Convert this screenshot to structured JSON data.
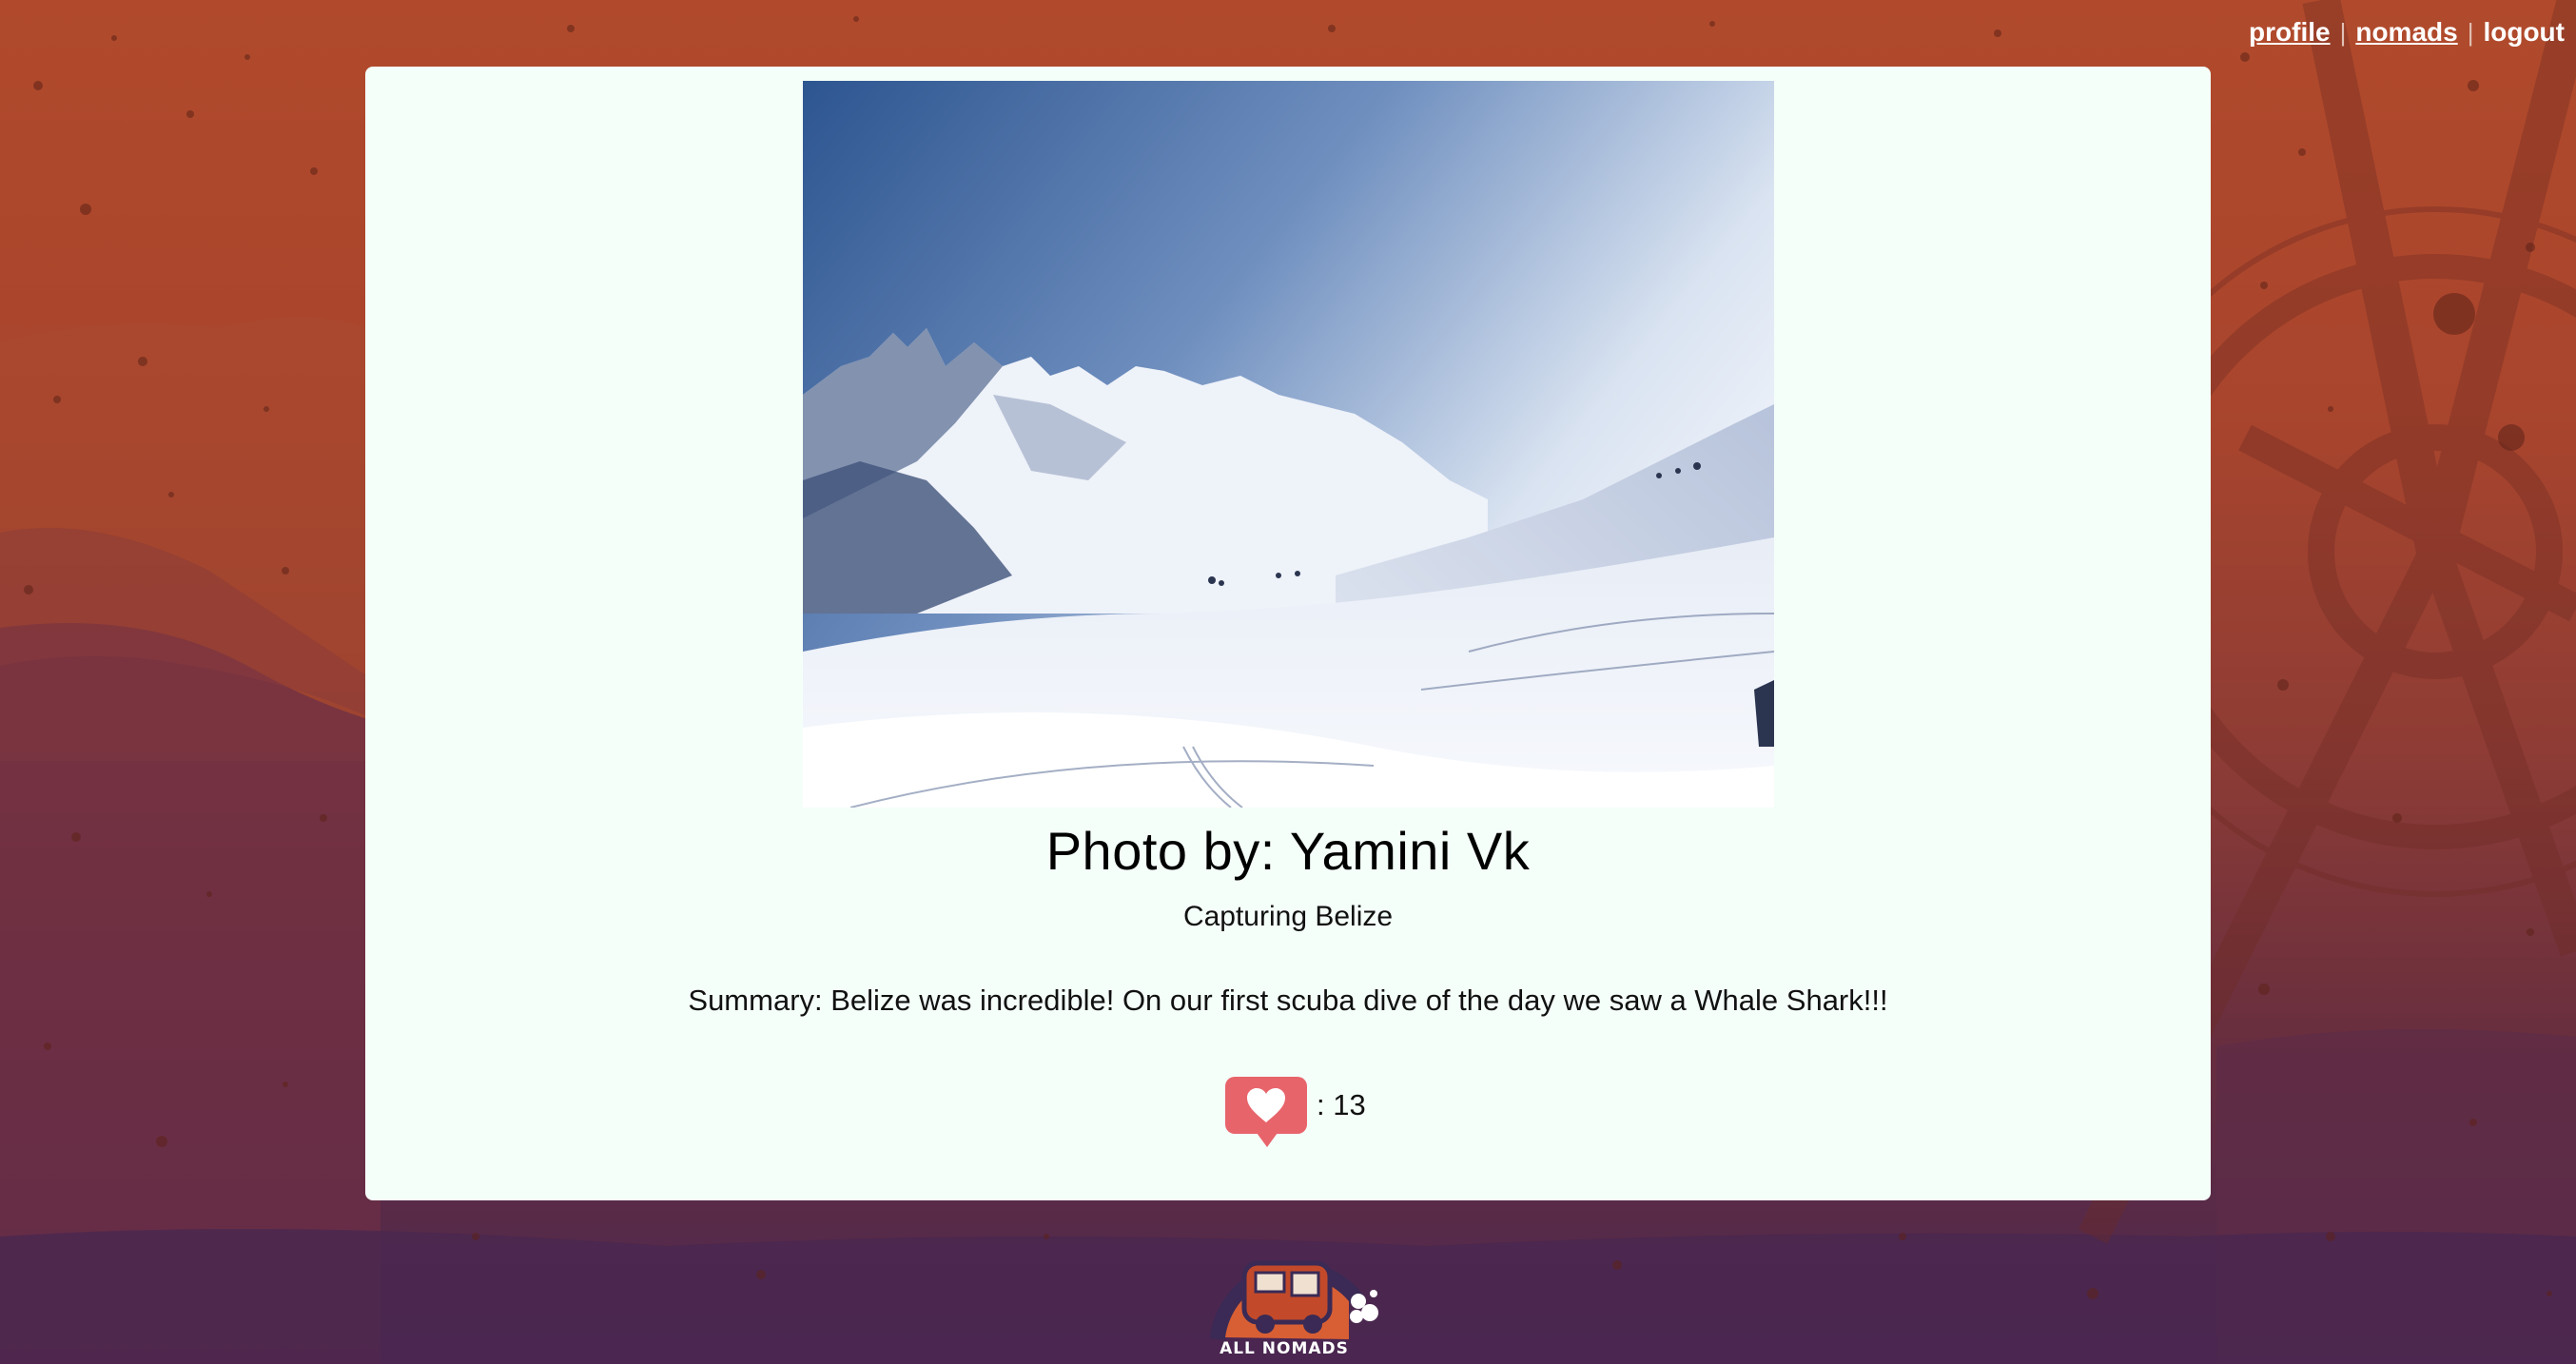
{
  "nav": {
    "profile": "profile",
    "separator": "|",
    "nomads": "nomads",
    "logout": "logout"
  },
  "post": {
    "title": "Photo by: Yamini Vk",
    "caption": "Capturing Belize",
    "summary": "Summary: Belize was incredible! On our first scuba dive of the day we saw a Whale Shark!!!",
    "likes_text": ": 13",
    "likes": 13
  },
  "footer": {
    "logo_text": "ALL NOMADS"
  },
  "colors": {
    "like_button": "#e8646b",
    "card_background": "#f5fff9",
    "background_top": "#b14a2c",
    "background_bottom": "#4a2750"
  },
  "icons": {
    "like": "heart-icon"
  }
}
